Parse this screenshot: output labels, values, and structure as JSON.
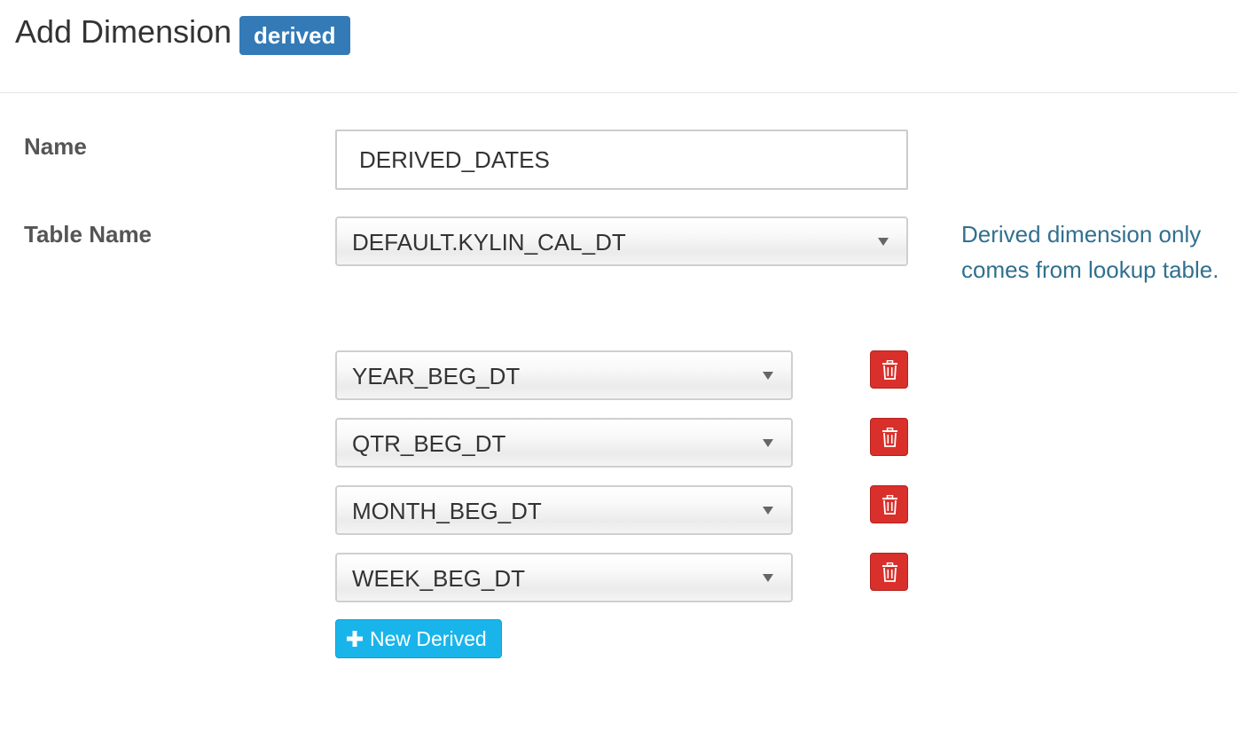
{
  "header": {
    "title": "Add Dimension",
    "badge": "derived"
  },
  "form": {
    "name_label": "Name",
    "name_value": "DERIVED_DATES",
    "table_label": "Table Name",
    "table_value": "DEFAULT.KYLIN_CAL_DT",
    "help_text": "Derived dimension only comes from lookup table."
  },
  "derived_columns": [
    "YEAR_BEG_DT",
    "QTR_BEG_DT",
    "MONTH_BEG_DT",
    "WEEK_BEG_DT"
  ],
  "buttons": {
    "new_derived": "New Derived"
  },
  "icons": {
    "caret": "caret-down-icon",
    "delete": "trash-icon",
    "add": "plus-icon"
  },
  "colors": {
    "badge": "#337ab7",
    "help_text": "#31708f",
    "delete_button": "#d9302b",
    "new_button": "#19b5ea"
  }
}
